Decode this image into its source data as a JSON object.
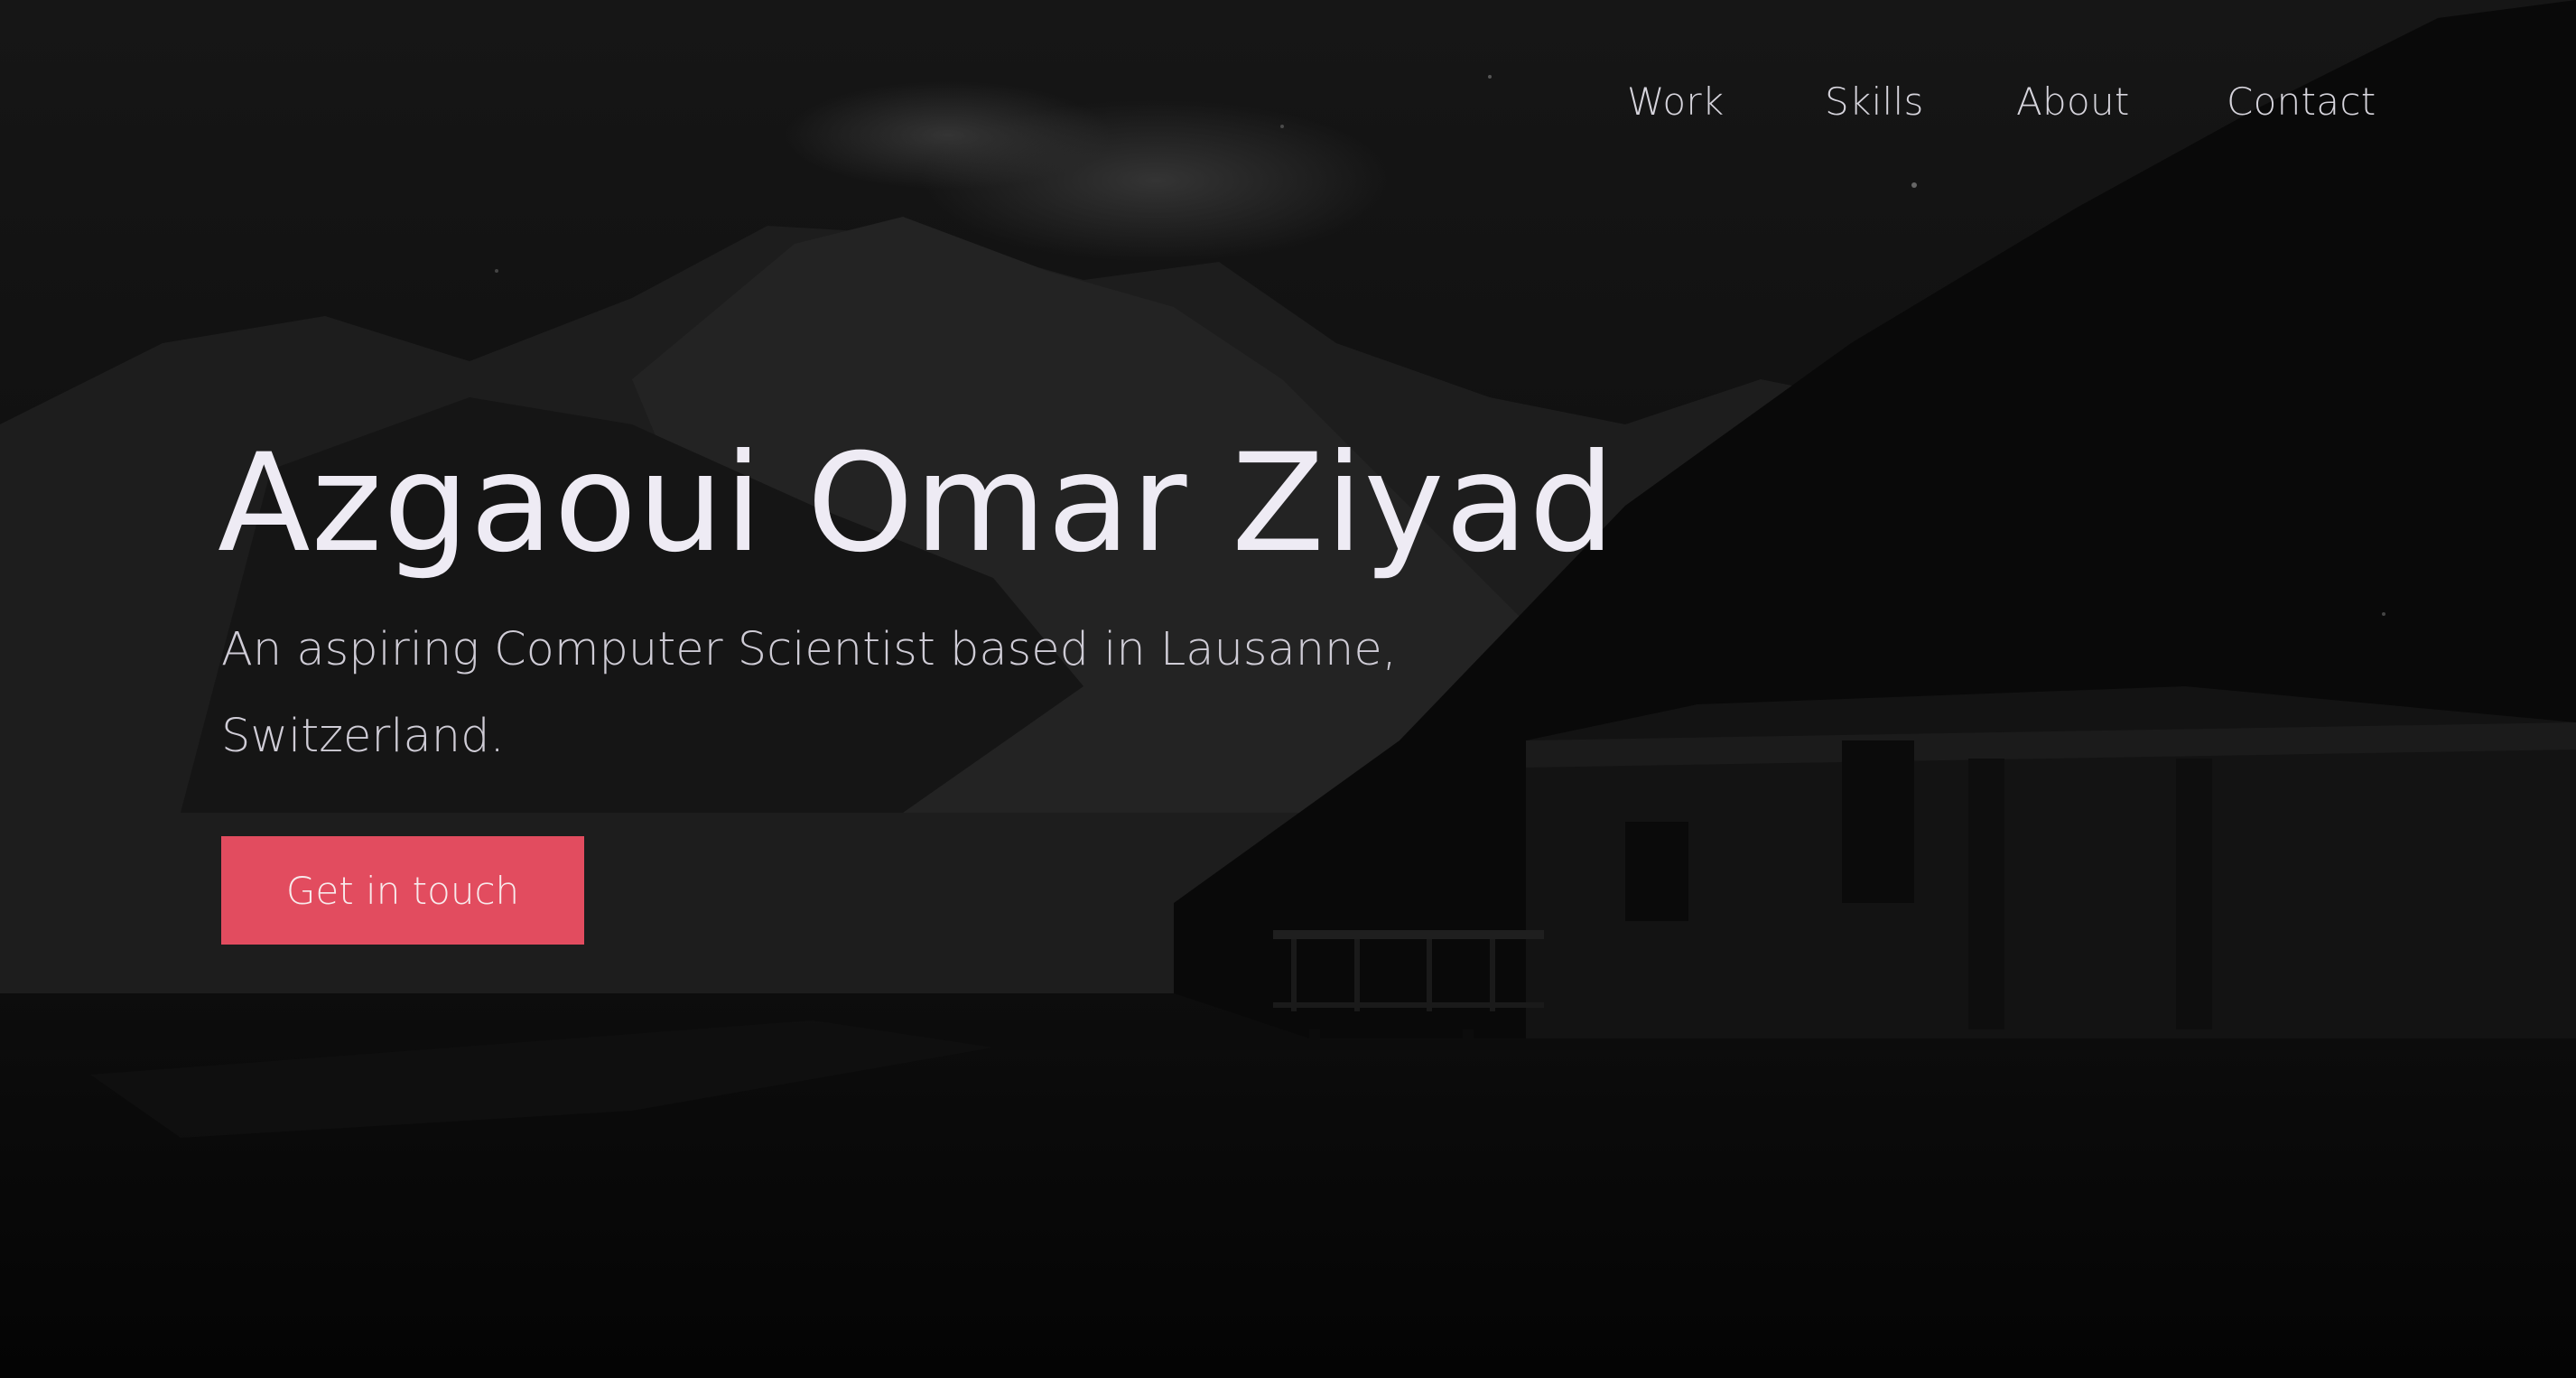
{
  "nav": {
    "items": [
      {
        "label": "Work"
      },
      {
        "label": "Skills"
      },
      {
        "label": "About"
      },
      {
        "label": "Contact"
      }
    ]
  },
  "hero": {
    "title": "Azgaoui Omar Ziyad",
    "subtitle": "An aspiring Computer Scientist based in Lausanne, Switzerland.",
    "cta_label": "Get in touch",
    "background_image": "dark-mountain-lake-boathouse"
  },
  "colors": {
    "accent": "#e24c5f",
    "title_text": "#eeebf4",
    "body_text": "#cfccd6",
    "background": "#060606"
  }
}
